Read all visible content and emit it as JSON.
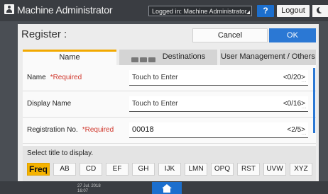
{
  "topbar": {
    "title": "Machine Administrator",
    "login_status": "Logged in: Machine Administrator",
    "help_label": "?",
    "logout_label": "Logout"
  },
  "dialog": {
    "title": "Register :",
    "cancel_label": "Cancel",
    "ok_label": "OK"
  },
  "tabs": [
    {
      "label": "Name",
      "active": true
    },
    {
      "label": "Destinations",
      "active": false
    },
    {
      "label": "User Management / Others",
      "active": false
    }
  ],
  "fields": [
    {
      "label": "Name",
      "required": "*Required",
      "value": "Touch to Enter",
      "count": "<0/20>"
    },
    {
      "label": "Display Name",
      "required": "",
      "value": "Touch to Enter",
      "count": "<0/16>"
    },
    {
      "label": "Registration No.",
      "required": "*Required",
      "value": "00018",
      "count": "<2/5>"
    }
  ],
  "title_select": {
    "label": "Select title to display.",
    "keys": [
      "Freq",
      "AB",
      "CD",
      "EF",
      "GH",
      "IJK",
      "LMN",
      "OPQ",
      "RST",
      "UVW",
      "XYZ"
    ],
    "selected": "Freq"
  },
  "bottombar": {
    "date": "27 Jul. 2018",
    "time": "16:07"
  },
  "colors": {
    "accent_blue": "#2b78d4",
    "selected_yellow": "#f5b300",
    "required_red": "#d0362b"
  },
  "icons": {
    "user": "user-icon",
    "moon": "moon-icon",
    "home": "home-icon",
    "destinations": "address-book-icon"
  }
}
